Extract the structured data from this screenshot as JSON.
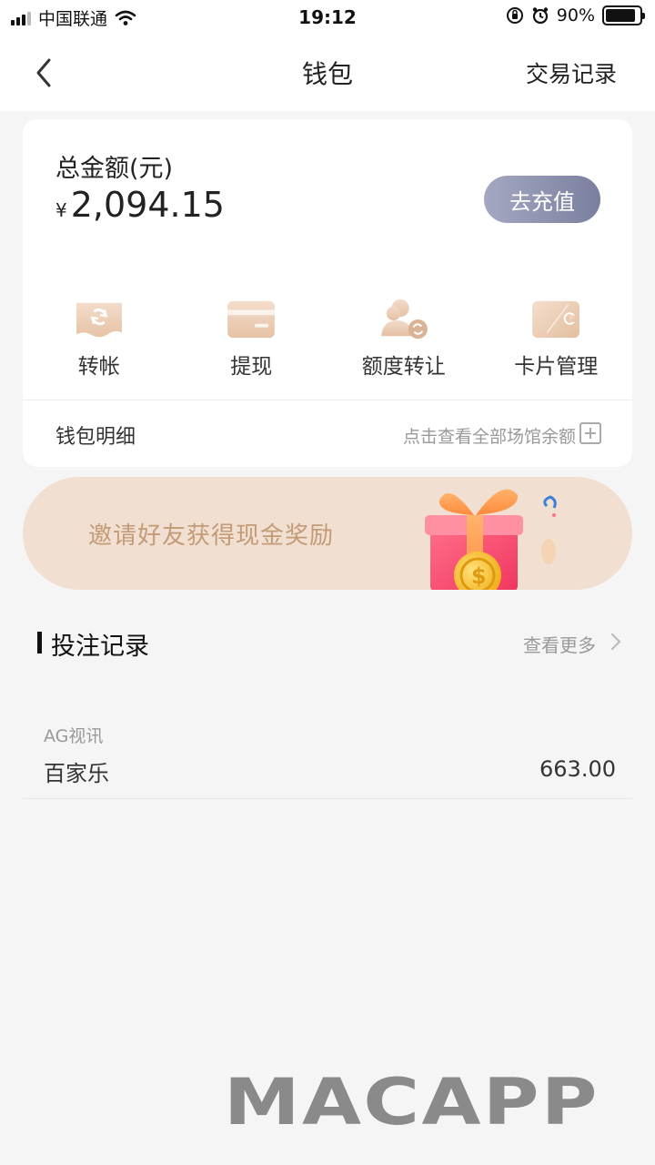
{
  "status_bar": {
    "carrier": "中国联通",
    "time": "19:12",
    "battery": "90%",
    "battery_level": 0.9
  },
  "nav": {
    "title": "钱包",
    "right_label": "交易记录"
  },
  "wallet": {
    "total_label": "总金额(元)",
    "currency_symbol": "¥",
    "total_amount": "2,094.15",
    "recharge_label": "去充值",
    "actions": [
      {
        "label": "转帐",
        "icon": "transfer-icon"
      },
      {
        "label": "提现",
        "icon": "withdraw-card-icon"
      },
      {
        "label": "额度转让",
        "icon": "quota-transfer-icon"
      },
      {
        "label": "卡片管理",
        "icon": "card-manage-icon"
      }
    ],
    "detail_label": "钱包明细",
    "detail_hint": "点击查看全部场馆余额"
  },
  "banner": {
    "text": "邀请好友获得现金奖励"
  },
  "bets": {
    "title": "投注记录",
    "more_label": "查看更多",
    "items": [
      {
        "provider": "AG视讯",
        "game": "百家乐",
        "amount": "663.00"
      }
    ]
  },
  "watermark": {
    "text": "MACAPP"
  },
  "colors": {
    "recharge_gradient_start": "#a4a8c2",
    "recharge_gradient_end": "#7a7f9e",
    "banner_bg": "#f1dfd1",
    "banner_text": "#c39b76",
    "icon_gold": "#e9c8ae"
  }
}
